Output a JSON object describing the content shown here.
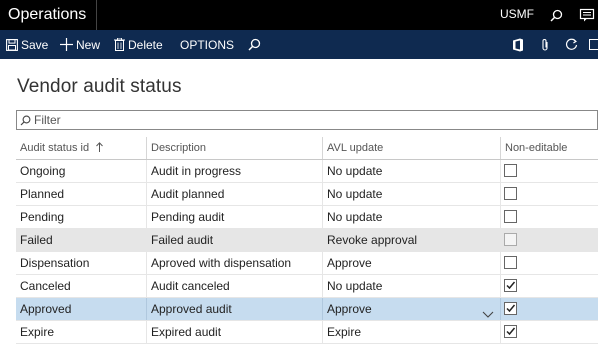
{
  "navbar": {
    "title": "Operations",
    "company": "USMF"
  },
  "actions": {
    "save": "Save",
    "new": "New",
    "delete": "Delete",
    "options": "OPTIONS"
  },
  "page": {
    "title": "Vendor audit status"
  },
  "filter": {
    "placeholder": "Filter",
    "value": ""
  },
  "grid": {
    "columns": [
      "Audit status id",
      "Description",
      "AVL update",
      "Non-editable"
    ],
    "rows": [
      {
        "id": "Ongoing",
        "description": "Audit in progress",
        "avl": "No update",
        "non_editable": false
      },
      {
        "id": "Planned",
        "description": "Audit planned",
        "avl": "No update",
        "non_editable": false
      },
      {
        "id": "Pending",
        "description": "Pending audit",
        "avl": "No update",
        "non_editable": false
      },
      {
        "id": "Failed",
        "description": "Failed audit",
        "avl": "Revoke approval",
        "non_editable": false
      },
      {
        "id": "Dispensation",
        "description": "Aproved with dispensation",
        "avl": "Approve",
        "non_editable": false
      },
      {
        "id": "Canceled",
        "description": "Audit canceled",
        "avl": "No update",
        "non_editable": true
      },
      {
        "id": "Approved",
        "description": "Approved audit",
        "avl": "Approve",
        "non_editable": true
      },
      {
        "id": "Expire",
        "description": "Expired audit",
        "avl": "Expire",
        "non_editable": true
      }
    ],
    "sort": {
      "column": "Audit status id",
      "direction": "ascending"
    },
    "shaded_row": 3,
    "selected_row": 6
  },
  "colors": {
    "navbar": "#000000",
    "actionbar": "#0f2a50",
    "selected_row": "#c6dcef",
    "shaded_row": "#e6e6e6"
  }
}
